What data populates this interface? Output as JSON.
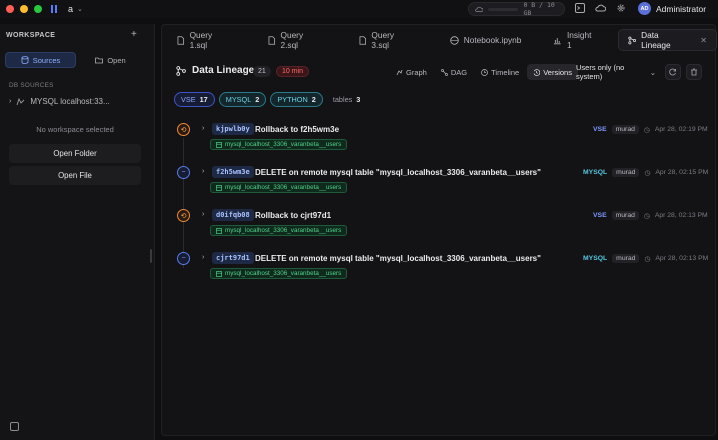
{
  "titlebar": {
    "project": "a",
    "memory": "0 B / 10 GB",
    "user_initials": "AD",
    "user_name": "Administrator",
    "icons": [
      "terminal-icon",
      "cloud-icon",
      "gear-icon"
    ]
  },
  "sidebar": {
    "title": "WORKSPACE",
    "tabs": [
      {
        "label": "Sources",
        "active": true
      },
      {
        "label": "Open",
        "active": false
      }
    ],
    "db_sources_label": "DB SOURCES",
    "db_item": "MYSQL localhost:33...",
    "empty_text": "No workspace selected",
    "open_folder": "Open Folder",
    "open_file": "Open File"
  },
  "tabs": [
    {
      "label": "Query 1.sql",
      "icon": "file-icon"
    },
    {
      "label": "Query 2.sql",
      "icon": "file-icon"
    },
    {
      "label": "Query 3.sql",
      "icon": "file-icon"
    },
    {
      "label": "Notebook.ipynb",
      "icon": "notebook-icon"
    },
    {
      "label": "Insight 1",
      "icon": "chart-icon"
    },
    {
      "label": "Data Lineage",
      "icon": "lineage-icon",
      "active": true
    }
  ],
  "lineage": {
    "title": "Data Lineage",
    "count": "21",
    "min_badge": "10 min",
    "views": [
      {
        "label": "Graph",
        "active": false
      },
      {
        "label": "DAG",
        "active": false
      },
      {
        "label": "Timeline",
        "active": false
      },
      {
        "label": "Versions",
        "active": true
      }
    ],
    "filter": "Users only (no system)",
    "pills": [
      {
        "label": "VSE",
        "count": "17",
        "kind": "vse"
      },
      {
        "label": "MYSQL",
        "count": "2",
        "kind": "mysql"
      },
      {
        "label": "PYTHON",
        "count": "2",
        "kind": "python"
      },
      {
        "label": "tables",
        "count": "3",
        "kind": "tables"
      }
    ],
    "entries": [
      {
        "hash": "kjpwlb0y",
        "message": "Rollback to f2h5wm3e",
        "table": "mysql_localhost_3306_varanbeta__users",
        "source": "VSE",
        "user": "murad",
        "time": "Apr 28, 02:19 PM",
        "node": "orange"
      },
      {
        "hash": "f2h5wm3e",
        "message": "DELETE on remote mysql table \"mysql_localhost_3306_varanbeta__users\"",
        "table": "mysql_localhost_3306_varanbeta__users",
        "source": "MYSQL",
        "user": "murad",
        "time": "Apr 28, 02:15 PM",
        "node": "blue"
      },
      {
        "hash": "d0ifqb08",
        "message": "Rollback to cjrt97d1",
        "table": "mysql_localhost_3306_varanbeta__users",
        "source": "VSE",
        "user": "murad",
        "time": "Apr 28, 02:13 PM",
        "node": "orange"
      },
      {
        "hash": "cjrt97d1",
        "message": "DELETE on remote mysql table \"mysql_localhost_3306_varanbeta__users\"",
        "table": "mysql_localhost_3306_varanbeta__users",
        "source": "MYSQL",
        "user": "murad",
        "time": "Apr 28, 02:13 PM",
        "node": "blue"
      }
    ]
  },
  "colors": {
    "accent": "#5b7cfa",
    "vse": "#7e98ff",
    "mysql": "#55c8e0",
    "table_tag": "#4fd18a",
    "rollback": "#e88a3a"
  }
}
